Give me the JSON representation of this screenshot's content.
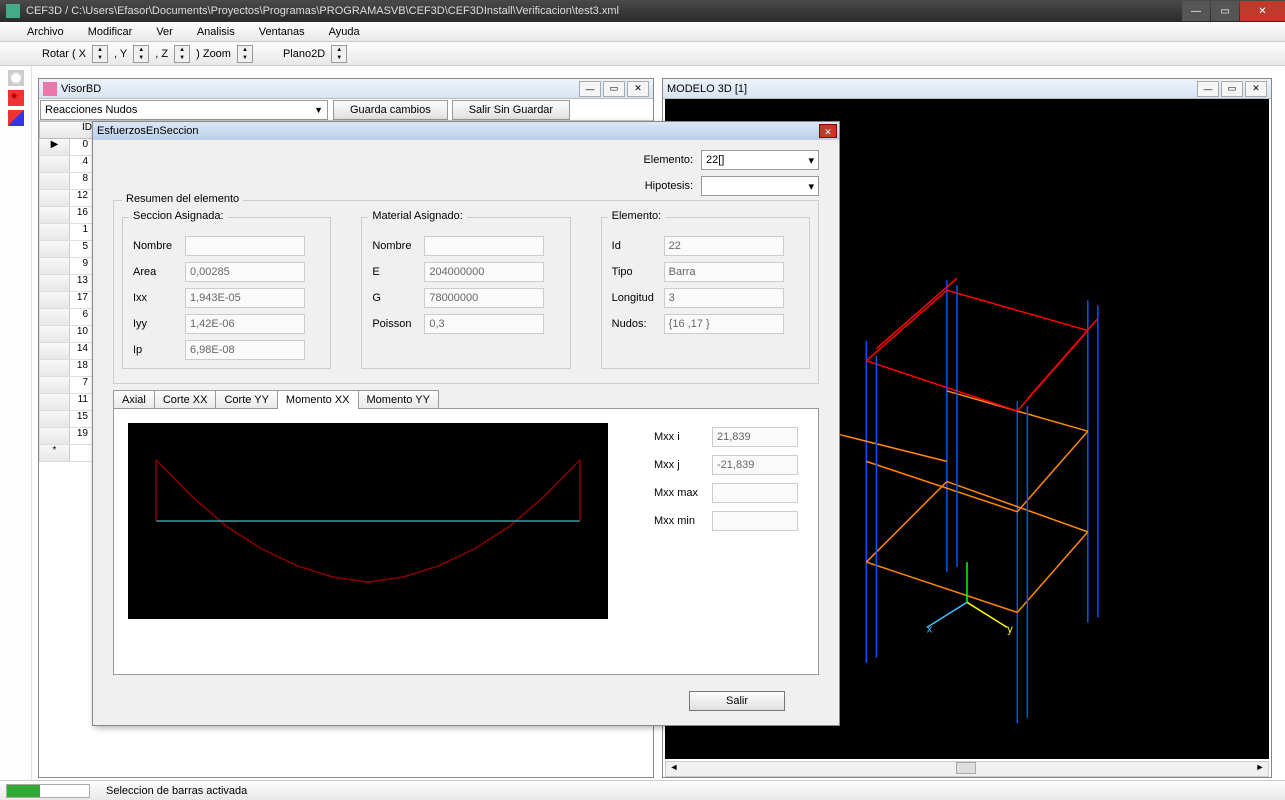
{
  "app": {
    "title": "CEF3D / C:\\Users\\Efasor\\Documents\\Proyectos\\Programas\\PROGRAMASVB\\CEF3D\\CEF3DInstall\\Verificacion\\test3.xml"
  },
  "menu": {
    "items": [
      "Archivo",
      "Modificar",
      "Ver",
      "Analisis",
      "Ventanas",
      "Ayuda"
    ]
  },
  "toolbar": {
    "rotar": "Rotar ( X",
    "y": ", Y",
    "z": ", Z",
    "zoom": ") Zoom",
    "plano2d": "Plano2D"
  },
  "visorbd": {
    "title": "VisorBD",
    "combo_value": "Reacciones Nudos",
    "btn_save": "Guarda cambios",
    "btn_exit": "Salir Sin Guardar",
    "col_id": "ID",
    "col_main": "EsfuerzosEnSeccion",
    "rows": [
      "0",
      "4",
      "8",
      "12",
      "16",
      "1",
      "5",
      "9",
      "13",
      "17",
      "6",
      "10",
      "14",
      "18",
      "7",
      "11",
      "15",
      "19"
    ]
  },
  "modelo3d": {
    "title": "MODELO 3D  [1]"
  },
  "dialog": {
    "title": "EsfuerzosEnSeccion",
    "elemento_label": "Elemento:",
    "elemento_value": "22[]",
    "hipotesis_label": "Hipotesis:",
    "hipotesis_value": "",
    "group_title": "Resumen del elemento",
    "seccion": {
      "title": "Seccion Asignada:",
      "nombre_label": "Nombre",
      "nombre_value": "",
      "area_label": "Area",
      "area_value": "0,00285",
      "ixx_label": "Ixx",
      "ixx_value": "1,943E-05",
      "iyy_label": "Iyy",
      "iyy_value": "1,42E-06",
      "ip_label": "Ip",
      "ip_value": "6,98E-08"
    },
    "material": {
      "title": "Material Asignado:",
      "nombre_label": "Nombre",
      "nombre_value": "",
      "e_label": "E",
      "e_value": "204000000",
      "g_label": "G",
      "g_value": "78000000",
      "poisson_label": "Poisson",
      "poisson_value": "0,3"
    },
    "elemento_group": {
      "title": "Elemento:",
      "id_label": "Id",
      "id_value": "22",
      "tipo_label": "Tipo",
      "tipo_value": "Barra",
      "longitud_label": "Longitud",
      "longitud_value": "3",
      "nudos_label": "Nudos:",
      "nudos_value": "{16 ,17 }"
    },
    "tabs": [
      "Axial",
      "Corte XX",
      "Corte YY",
      "Momento XX",
      "Momento YY"
    ],
    "active_tab": 3,
    "mxx": {
      "i_label": "Mxx i",
      "i_value": "21,839",
      "j_label": "Mxx j",
      "j_value": "-21,839",
      "max_label": "Mxx  max",
      "max_value": "",
      "min_label": "Mxx min",
      "min_value": ""
    },
    "salir": "Salir"
  },
  "status": {
    "text": "Seleccion de barras activada"
  },
  "chart_data": {
    "type": "line",
    "title": "Momento XX",
    "x": [
      0,
      0.25,
      0.5,
      0.75,
      1.0,
      1.25,
      1.5,
      1.75,
      2.0,
      2.25,
      2.5,
      2.75,
      3.0
    ],
    "series": [
      {
        "name": "moment_curve",
        "values": [
          21.839,
          9.0,
          -2.0,
          -10.0,
          -16.0,
          -20.0,
          -21.839,
          -20.0,
          -16.0,
          -10.0,
          -2.0,
          9.0,
          21.839
        ],
        "color": "#8b0000"
      },
      {
        "name": "baseline",
        "values": [
          0,
          0,
          0,
          0,
          0,
          0,
          0,
          0,
          0,
          0,
          0,
          0,
          0
        ],
        "color": "#3b9aa0"
      }
    ],
    "xlabel": "",
    "ylabel": "",
    "xlim": [
      0,
      3
    ],
    "ylim": [
      -25,
      25
    ]
  }
}
